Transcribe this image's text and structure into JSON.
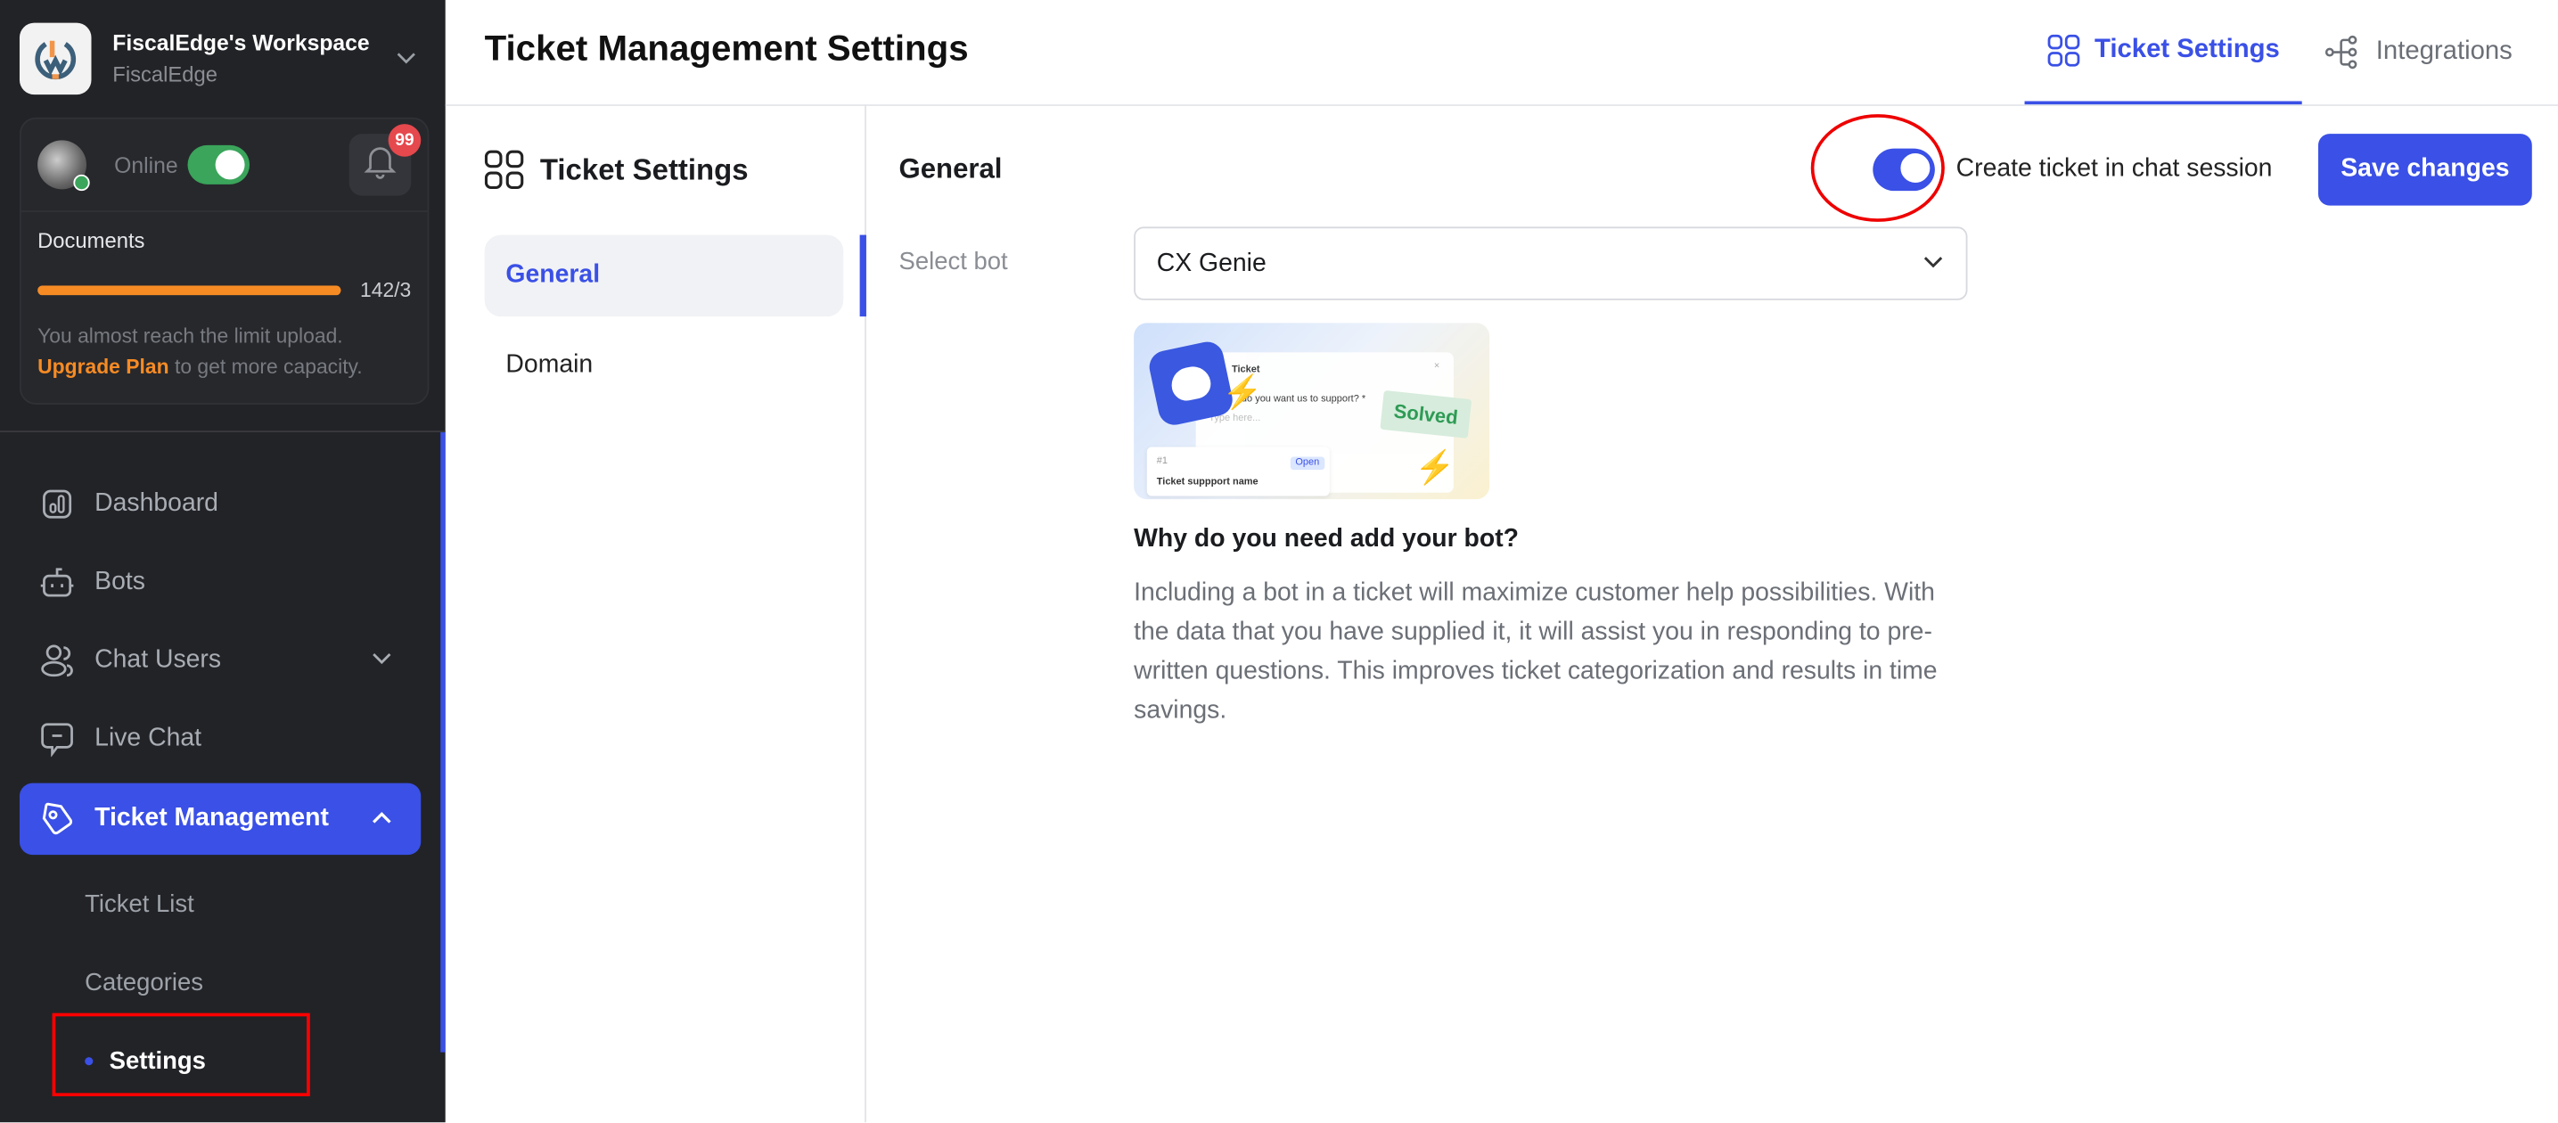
{
  "workspace": {
    "title": "FiscalEdge's Workspace",
    "subtitle": "FiscalEdge"
  },
  "status": {
    "label": "Online",
    "online": true,
    "notifications_count": "99"
  },
  "documents": {
    "title": "Documents",
    "progress_value": "142/3",
    "progress_fraction": 1.0,
    "note": "You almost reach the limit upload.",
    "upgrade_link": "Upgrade Plan",
    "upgrade_suffix": "to get more capacity."
  },
  "nav": {
    "items": [
      {
        "label": "Dashboard",
        "icon": "dashboard-icon"
      },
      {
        "label": "Bots",
        "icon": "bot-icon"
      },
      {
        "label": "Chat Users",
        "icon": "users-icon"
      },
      {
        "label": "Live Chat",
        "icon": "chat-icon"
      },
      {
        "label": "Ticket Management",
        "icon": "ticket-icon"
      }
    ],
    "sub_items": [
      {
        "label": "Ticket List"
      },
      {
        "label": "Categories"
      },
      {
        "label": "Settings"
      }
    ]
  },
  "header": {
    "title": "Ticket Management Settings",
    "tabs": [
      {
        "label": "Ticket Settings",
        "active": true
      },
      {
        "label": "Integrations",
        "active": false
      }
    ]
  },
  "subnav": {
    "title": "Ticket Settings",
    "items": [
      {
        "label": "General",
        "active": true
      },
      {
        "label": "Domain",
        "active": false
      }
    ]
  },
  "general": {
    "title": "General",
    "toggle_label": "Create ticket in chat session",
    "toggle_on": true,
    "save_label": "Save changes",
    "select_bot_label": "Select bot",
    "select_bot_value": "CX Genie",
    "illustration": {
      "ticket_title": "Ticket",
      "question": "do you want us to support? *",
      "placeholder": "Type here...",
      "solved": "Solved",
      "ticket_no": "#1",
      "open": "Open",
      "ticket_name": "Ticket suppport name"
    },
    "why_title": "Why do you need add your bot?",
    "why_desc": "Including a bot in a ticket will maximize customer help possibilities. With the data that you have supplied it, it will assist you in responding to pre-written questions. This improves ticket categorization and results in time savings."
  },
  "colors": {
    "accent": "#3a50e6",
    "sidebar_bg": "#222327",
    "warning": "#f68b24",
    "online": "#3aa55b",
    "badge": "#e5484d"
  }
}
